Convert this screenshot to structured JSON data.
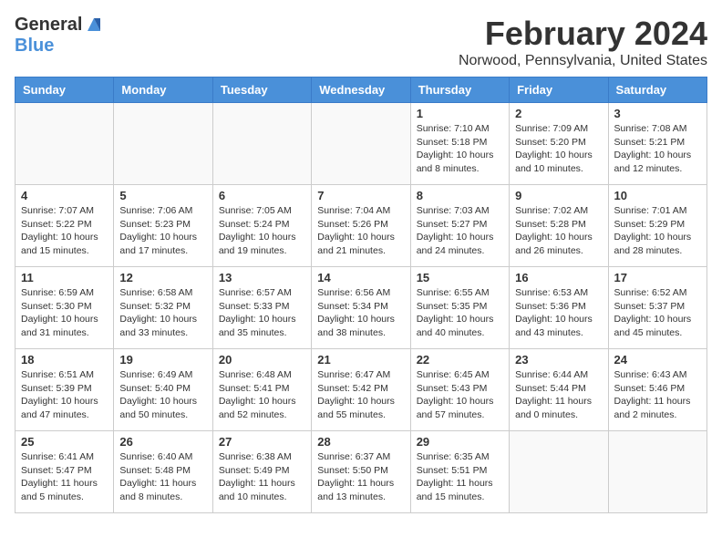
{
  "header": {
    "logo_general": "General",
    "logo_blue": "Blue",
    "month_title": "February 2024",
    "location": "Norwood, Pennsylvania, United States"
  },
  "days_of_week": [
    "Sunday",
    "Monday",
    "Tuesday",
    "Wednesday",
    "Thursday",
    "Friday",
    "Saturday"
  ],
  "weeks": [
    [
      {
        "day": "",
        "info": ""
      },
      {
        "day": "",
        "info": ""
      },
      {
        "day": "",
        "info": ""
      },
      {
        "day": "",
        "info": ""
      },
      {
        "day": "1",
        "info": "Sunrise: 7:10 AM\nSunset: 5:18 PM\nDaylight: 10 hours\nand 8 minutes."
      },
      {
        "day": "2",
        "info": "Sunrise: 7:09 AM\nSunset: 5:20 PM\nDaylight: 10 hours\nand 10 minutes."
      },
      {
        "day": "3",
        "info": "Sunrise: 7:08 AM\nSunset: 5:21 PM\nDaylight: 10 hours\nand 12 minutes."
      }
    ],
    [
      {
        "day": "4",
        "info": "Sunrise: 7:07 AM\nSunset: 5:22 PM\nDaylight: 10 hours\nand 15 minutes."
      },
      {
        "day": "5",
        "info": "Sunrise: 7:06 AM\nSunset: 5:23 PM\nDaylight: 10 hours\nand 17 minutes."
      },
      {
        "day": "6",
        "info": "Sunrise: 7:05 AM\nSunset: 5:24 PM\nDaylight: 10 hours\nand 19 minutes."
      },
      {
        "day": "7",
        "info": "Sunrise: 7:04 AM\nSunset: 5:26 PM\nDaylight: 10 hours\nand 21 minutes."
      },
      {
        "day": "8",
        "info": "Sunrise: 7:03 AM\nSunset: 5:27 PM\nDaylight: 10 hours\nand 24 minutes."
      },
      {
        "day": "9",
        "info": "Sunrise: 7:02 AM\nSunset: 5:28 PM\nDaylight: 10 hours\nand 26 minutes."
      },
      {
        "day": "10",
        "info": "Sunrise: 7:01 AM\nSunset: 5:29 PM\nDaylight: 10 hours\nand 28 minutes."
      }
    ],
    [
      {
        "day": "11",
        "info": "Sunrise: 6:59 AM\nSunset: 5:30 PM\nDaylight: 10 hours\nand 31 minutes."
      },
      {
        "day": "12",
        "info": "Sunrise: 6:58 AM\nSunset: 5:32 PM\nDaylight: 10 hours\nand 33 minutes."
      },
      {
        "day": "13",
        "info": "Sunrise: 6:57 AM\nSunset: 5:33 PM\nDaylight: 10 hours\nand 35 minutes."
      },
      {
        "day": "14",
        "info": "Sunrise: 6:56 AM\nSunset: 5:34 PM\nDaylight: 10 hours\nand 38 minutes."
      },
      {
        "day": "15",
        "info": "Sunrise: 6:55 AM\nSunset: 5:35 PM\nDaylight: 10 hours\nand 40 minutes."
      },
      {
        "day": "16",
        "info": "Sunrise: 6:53 AM\nSunset: 5:36 PM\nDaylight: 10 hours\nand 43 minutes."
      },
      {
        "day": "17",
        "info": "Sunrise: 6:52 AM\nSunset: 5:37 PM\nDaylight: 10 hours\nand 45 minutes."
      }
    ],
    [
      {
        "day": "18",
        "info": "Sunrise: 6:51 AM\nSunset: 5:39 PM\nDaylight: 10 hours\nand 47 minutes."
      },
      {
        "day": "19",
        "info": "Sunrise: 6:49 AM\nSunset: 5:40 PM\nDaylight: 10 hours\nand 50 minutes."
      },
      {
        "day": "20",
        "info": "Sunrise: 6:48 AM\nSunset: 5:41 PM\nDaylight: 10 hours\nand 52 minutes."
      },
      {
        "day": "21",
        "info": "Sunrise: 6:47 AM\nSunset: 5:42 PM\nDaylight: 10 hours\nand 55 minutes."
      },
      {
        "day": "22",
        "info": "Sunrise: 6:45 AM\nSunset: 5:43 PM\nDaylight: 10 hours\nand 57 minutes."
      },
      {
        "day": "23",
        "info": "Sunrise: 6:44 AM\nSunset: 5:44 PM\nDaylight: 11 hours\nand 0 minutes."
      },
      {
        "day": "24",
        "info": "Sunrise: 6:43 AM\nSunset: 5:46 PM\nDaylight: 11 hours\nand 2 minutes."
      }
    ],
    [
      {
        "day": "25",
        "info": "Sunrise: 6:41 AM\nSunset: 5:47 PM\nDaylight: 11 hours\nand 5 minutes."
      },
      {
        "day": "26",
        "info": "Sunrise: 6:40 AM\nSunset: 5:48 PM\nDaylight: 11 hours\nand 8 minutes."
      },
      {
        "day": "27",
        "info": "Sunrise: 6:38 AM\nSunset: 5:49 PM\nDaylight: 11 hours\nand 10 minutes."
      },
      {
        "day": "28",
        "info": "Sunrise: 6:37 AM\nSunset: 5:50 PM\nDaylight: 11 hours\nand 13 minutes."
      },
      {
        "day": "29",
        "info": "Sunrise: 6:35 AM\nSunset: 5:51 PM\nDaylight: 11 hours\nand 15 minutes."
      },
      {
        "day": "",
        "info": ""
      },
      {
        "day": "",
        "info": ""
      }
    ]
  ]
}
